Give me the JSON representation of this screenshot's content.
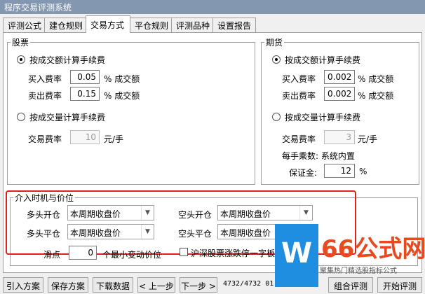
{
  "window": {
    "title": "程序交易评测系统"
  },
  "tabs": [
    "评测公式",
    "建仓规则",
    "交易方式",
    "平仓规则",
    "评测品种",
    "设置报告"
  ],
  "stock": {
    "title": "股票",
    "by_amount_label": "按成交额计算手续费",
    "buy_rate_label": "买入费率",
    "buy_rate_value": "0.05",
    "buy_rate_unit": "% 成交额",
    "sell_rate_label": "卖出费率",
    "sell_rate_value": "0.15",
    "sell_rate_unit": "% 成交额",
    "by_volume_label": "按成交量计算手续费",
    "trade_rate_label": "交易费率",
    "trade_rate_value": "10",
    "trade_rate_unit": "元/手"
  },
  "futures": {
    "title": "期货",
    "by_amount_label": "按成交额计算手续费",
    "buy_rate_label": "买入费率",
    "buy_rate_value": "0.0025",
    "buy_rate_unit": "% 成交额",
    "sell_rate_label": "卖出费率",
    "sell_rate_value": "0.0025",
    "sell_rate_unit": "% 成交额",
    "by_volume_label": "按成交量计算手续费",
    "trade_rate_label": "交易费率",
    "trade_rate_value": "3",
    "trade_rate_unit": "元/手",
    "multiplier_text": "每手乘数: 系统内置",
    "margin_label": "保证金:",
    "margin_value": "12",
    "margin_unit": "%"
  },
  "entry": {
    "title": "介入时机与价位",
    "long_open_label": "多头开仓",
    "long_open_value": "本周期收盘价",
    "short_open_label": "空头开仓",
    "short_open_value": "本周期收盘价",
    "long_close_label": "多头平仓",
    "long_close_value": "本周期收盘价",
    "short_close_label": "空头平仓",
    "short_close_value": "本周期收盘价",
    "slippage_label": "滑点",
    "slippage_value": "0",
    "slippage_unit": "个最小变动价位",
    "limit_checkbox_label": "沪深股票涨跌停一字板"
  },
  "buttons": {
    "import": "引入方案",
    "save": "保存方案",
    "download": "下载数据",
    "prev": "< 上一步",
    "next": "下一步 >",
    "combo": "组合评测",
    "start": "开始评测"
  },
  "status_text": "4732/4732 01:17",
  "watermark": {
    "logo_glyph": "W",
    "big_text": "66公式网",
    "small_text": "聚集热门精选股指标公式"
  },
  "colors": {
    "title_bar": "#8497b0",
    "highlight_box": "#e02020"
  }
}
